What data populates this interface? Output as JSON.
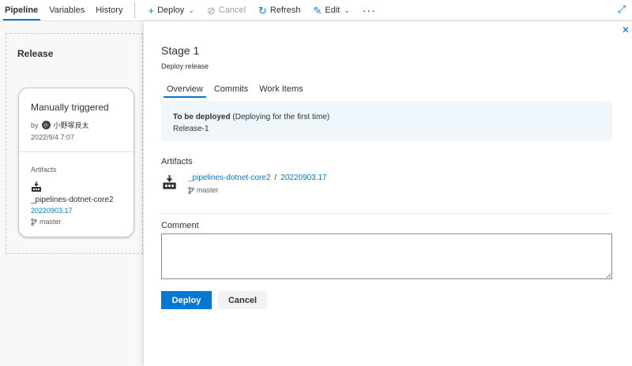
{
  "toolbar": {
    "tabs": [
      {
        "label": "Pipeline",
        "active": true
      },
      {
        "label": "Variables"
      },
      {
        "label": "History"
      }
    ],
    "deploy_label": "Deploy",
    "cancel_label": "Cancel",
    "refresh_label": "Refresh",
    "edit_label": "Edit",
    "more_label": "···"
  },
  "canvas": {
    "release_title": "Release",
    "trigger_card": {
      "title": "Manually triggered",
      "by_label": "by",
      "avatar_initials": "小",
      "user": "小野塚良太",
      "date": "2022/9/4 7:07",
      "artifacts_label": "Artifacts",
      "artifact_name": "_pipelines-dotnet-core2",
      "artifact_version": "20220903.17",
      "branch": "master"
    }
  },
  "panel": {
    "title": "Stage 1",
    "subtitle": "Deploy release",
    "tabs": [
      {
        "label": "Overview",
        "active": true
      },
      {
        "label": "Commits"
      },
      {
        "label": "Work Items"
      }
    ],
    "info": {
      "heading": "To be deployed",
      "heading_note": "(Deploying for the first time)",
      "release": "Release-1"
    },
    "artifacts_label": "Artifacts",
    "artifact_name": "_pipelines-dotnet-core2",
    "artifact_separator": "/",
    "artifact_version": "20220903.17",
    "branch": "master",
    "comment_label": "Comment",
    "comment_value": "",
    "deploy_button": "Deploy",
    "cancel_button": "Cancel"
  },
  "colors": {
    "accent": "#0078d4",
    "info_bg": "#eff6fc"
  }
}
